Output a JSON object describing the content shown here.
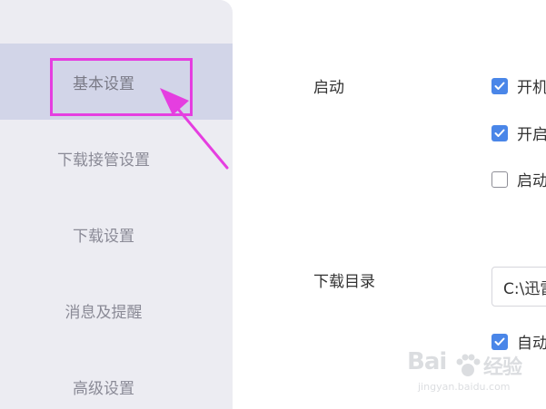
{
  "sidebar": {
    "items": [
      {
        "label": "基本设置",
        "active": true
      },
      {
        "label": "下载接管设置",
        "active": false
      },
      {
        "label": "下载设置",
        "active": false
      },
      {
        "label": "消息及提醒",
        "active": false
      },
      {
        "label": "高级设置",
        "active": false
      }
    ]
  },
  "main": {
    "startup": {
      "label": "启动",
      "options": [
        {
          "text": "开机",
          "checked": true
        },
        {
          "text": "开启",
          "checked": true
        },
        {
          "text": "启动",
          "checked": false
        }
      ]
    },
    "download_dir": {
      "label": "下载目录",
      "path_value": "C:\\迅雷",
      "auto_option": {
        "text": "自动",
        "checked": true
      }
    }
  },
  "annotation": {
    "color": "#e53ee0"
  },
  "watermark": {
    "brand": "Bai",
    "brand_suffix": "经验",
    "url": "jingyan.baidu.com"
  },
  "colors": {
    "accent": "#4a86e8",
    "sidebar_bg": "#ececf2",
    "sidebar_active_bg": "#d2d5e8"
  }
}
